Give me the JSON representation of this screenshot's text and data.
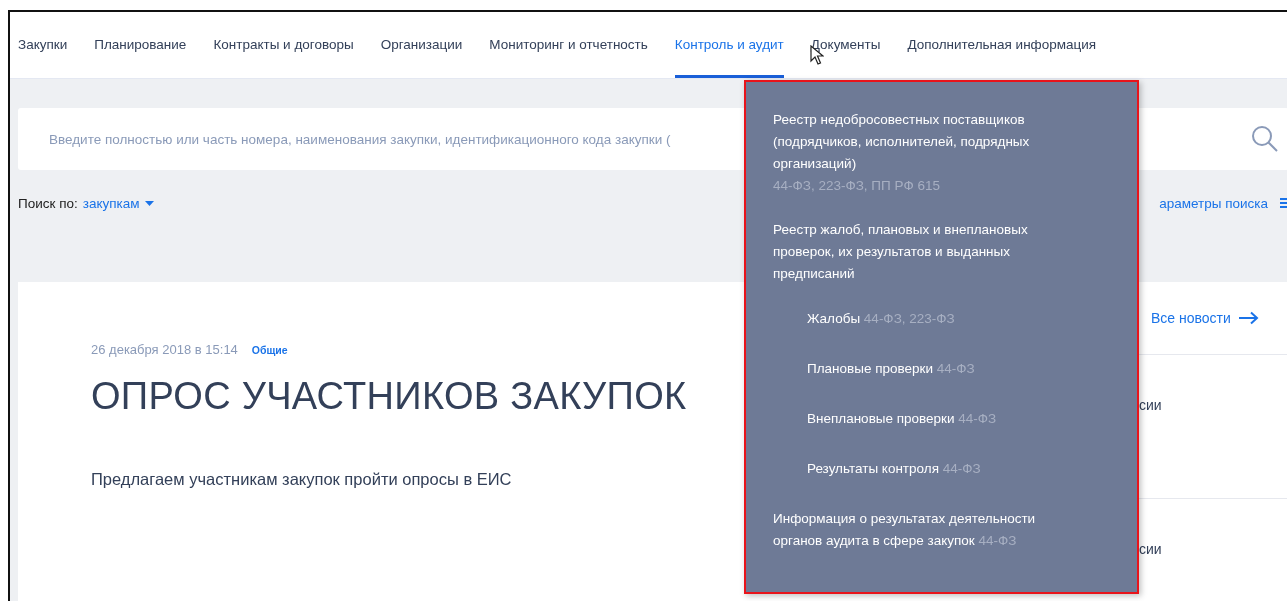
{
  "nav": [
    {
      "label": "Закупки",
      "selected": false
    },
    {
      "label": "Планирование",
      "selected": false
    },
    {
      "label": "Контракты и договоры",
      "selected": false
    },
    {
      "label": "Организации",
      "selected": false
    },
    {
      "label": "Мониторинг и отчетность",
      "selected": false
    },
    {
      "label": "Контроль и аудит",
      "selected": true
    },
    {
      "label": "Документы",
      "selected": false
    },
    {
      "label": "Дополнительная информация",
      "selected": false
    }
  ],
  "search": {
    "placeholder": "Введите полностью или часть номера, наименования закупки, идентификационного кода закупки ("
  },
  "search_by": {
    "label": "Поиск по:",
    "value": "закупкам"
  },
  "search_params": "араметры поиска",
  "news": {
    "date": "26 декабря 2018 в 15:14",
    "tag": "Общие",
    "title": "ОПРОС УЧАСТНИКОВ ЗАКУПОК",
    "text": "Предлагаем участникам закупок пройти опросы в ЕИС"
  },
  "all_news": "Все новости",
  "side_items": [
    "сии",
    "сии"
  ],
  "menu": {
    "items": [
      {
        "text": "Реестр недобросовестных поставщиков (подрядчиков, исполнителей, подрядных организаций)",
        "laws": "44-ФЗ, 223-ФЗ, ПП РФ 615",
        "laws_below": true
      },
      {
        "text": "Реестр жалоб, плановых и внеплановых проверок, их результатов и выданных предписаний",
        "children": [
          {
            "text": "Жалобы",
            "laws": "44-ФЗ, 223-ФЗ"
          },
          {
            "text": "Плановые проверки",
            "laws": "44-ФЗ"
          },
          {
            "text": "Внеплановые проверки",
            "laws": "44-ФЗ"
          },
          {
            "text": "Результаты контроля",
            "laws": "44-ФЗ"
          }
        ]
      },
      {
        "text": "Информация о результатах деятельности органов аудита в сфере закупок",
        "laws": "44-ФЗ",
        "laws_below": false
      }
    ]
  }
}
